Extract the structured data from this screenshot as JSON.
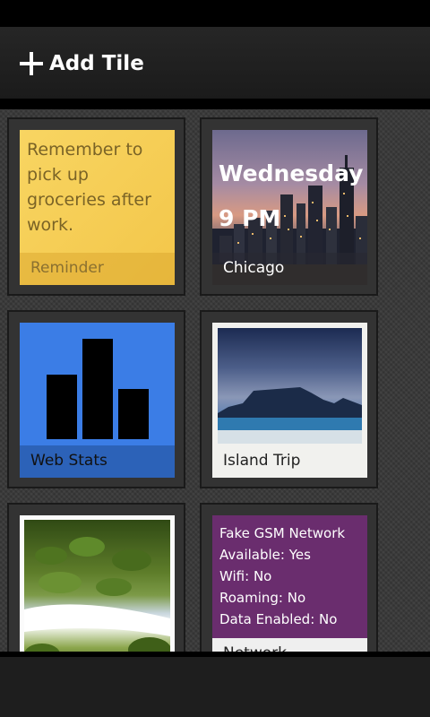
{
  "header": {
    "add_tile_label": "Add Tile",
    "icon": "plus-icon"
  },
  "tiles": {
    "reminder": {
      "note": "Remember to pick up groceries after work.",
      "label": "Reminder",
      "color": "#f6d05a"
    },
    "weather": {
      "weekday": "Wednesday",
      "time": "9 PM",
      "label": "Chicago"
    },
    "webstats": {
      "label": "Web Stats",
      "color": "#3b7de6",
      "icon": "bar-chart-icon"
    },
    "island": {
      "label": "Island Trip"
    },
    "nature": {
      "label": ""
    },
    "gsm": {
      "lines": [
        "Fake GSM Network",
        "Available: Yes",
        "Wifi: No",
        "Roaming: No",
        "Data Enabled: No"
      ],
      "label": "Network",
      "color": "#6a2d6e"
    }
  }
}
